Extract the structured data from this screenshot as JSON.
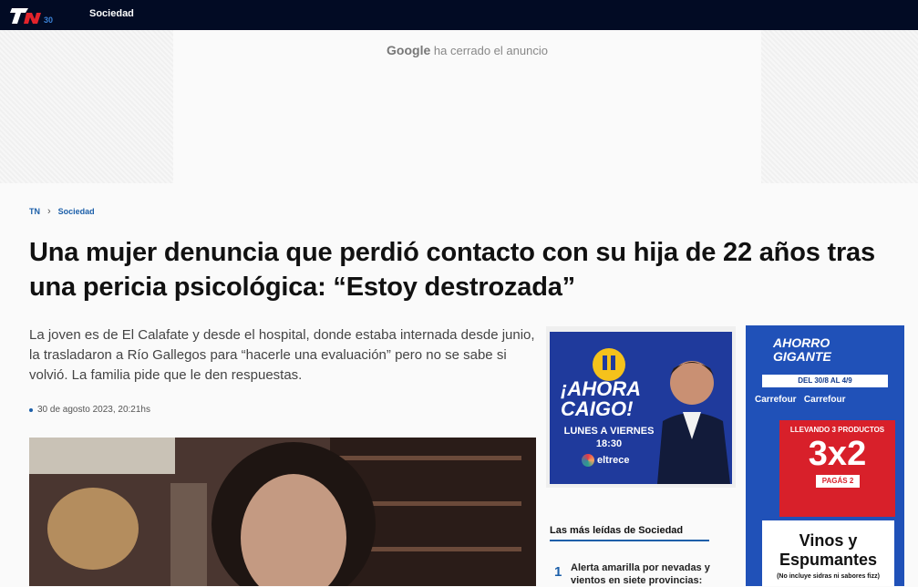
{
  "header": {
    "logo_text": "TN",
    "logo_badge": "30",
    "section_label": "Sociedad"
  },
  "ad_top": {
    "brand": "Google",
    "message": "ha cerrado el anuncio"
  },
  "breadcrumb": {
    "home": "TN",
    "section": "Sociedad"
  },
  "article": {
    "title": "Una mujer denuncia que perdió contacto con su hija de 22 años tras una pericia psicológica: “Estoy destrozada”",
    "lead": "La joven es de El Calafate y desde el hospital, donde estaba internada desde junio, la trasladaron a Río Gallegos para “hacerle una evaluación” pero no se sabe si volvió. La familia pide que le den respuestas.",
    "date": "30 de agosto 2023, 20:21hs"
  },
  "promo": {
    "title_line1": "¡AHORA",
    "title_line2": "CAIGO!",
    "days": "LUNES A VIERNES",
    "time": "18:30",
    "channel": "eltrece"
  },
  "most_read": {
    "heading": "Las más leídas de Sociedad",
    "items": [
      {
        "number": "1",
        "text": "Alerta amarilla por nevadas y vientos en siete provincias:"
      }
    ]
  },
  "ad_right": {
    "title_line1": "AHORRO",
    "title_line2": "GIGANTE",
    "dates": "DEL 30/8 AL 4/9",
    "brand1": "Carrefour",
    "brand2": "Carrefour",
    "offer_top": "LLEVANDO 3 PRODUCTOS",
    "offer_big": "3x2",
    "offer_pay": "PAGÁS 2",
    "product_line1": "Vinos y",
    "product_line2": "Espumantes",
    "note": "(No incluye sidras ni sabores fizz)"
  },
  "colors": {
    "topbar": "#020b24",
    "accent": "#1c5fa9",
    "ad_blue": "#2051b8",
    "ad_red": "#d8202a"
  }
}
